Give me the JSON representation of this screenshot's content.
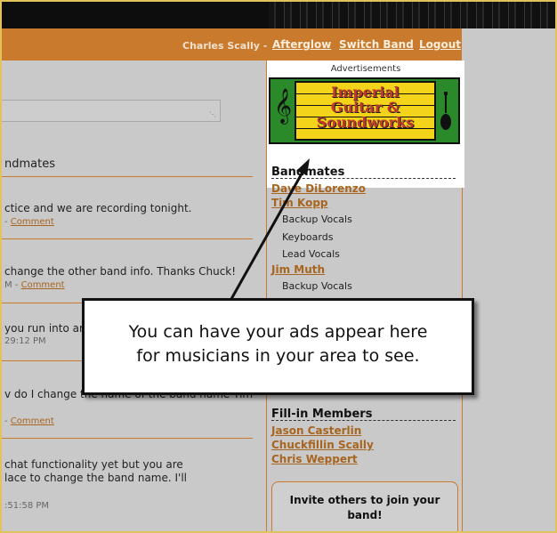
{
  "nav": {
    "user": "Charles Scally",
    "separator": "-",
    "links": [
      "Afterglow",
      "Switch Band",
      "Logout"
    ]
  },
  "left": {
    "bandmates_heading": "ndmates",
    "posts": [
      {
        "text": "ctice and we are recording tonight.",
        "meta": "- ",
        "comment": "Comment"
      },
      {
        "text": "change the other band info. Thanks Chuck!",
        "meta": "M - ",
        "comment": "Comment"
      },
      {
        "text": "you run into an",
        "meta": "29:12 PM",
        "comment": ""
      },
      {
        "text": "v do I change the name of the band name Tim",
        "meta": "- ",
        "comment": "Comment"
      },
      {
        "text": "chat functionality yet but you are",
        "text2": "lace to change the band name. I'll",
        "meta": ":51:58 PM",
        "comment": ""
      }
    ]
  },
  "ad": {
    "label": "Advertisements",
    "banner_lines": [
      "Imperial",
      "Guitar &",
      "Soundworks"
    ]
  },
  "bandmates": {
    "title": "Bandmates",
    "members": [
      {
        "name": "Dave  DiLorenzo",
        "roles": []
      },
      {
        "name": "Tim Kopp",
        "roles": [
          "Backup Vocals",
          "Keyboards",
          "Lead Vocals"
        ]
      },
      {
        "name": "Jim Muth",
        "roles": [
          "Backup Vocals"
        ]
      }
    ]
  },
  "fillin": {
    "title": "Fill-in Members",
    "members": [
      "Jason  Casterlin",
      "Chuckfillin Scally",
      "Chris Weppert"
    ]
  },
  "invite": {
    "line1": "Invite others to join your",
    "line2": "band!"
  },
  "callout": {
    "line1": "You can have your ads appear here",
    "line2": "for musicians in your area to see."
  },
  "colors": {
    "accent": "#c97a2c",
    "link": "#a8651f",
    "background": "#c9c9c9"
  },
  "icons": [
    "treble-clef-icon",
    "guitar-icon",
    "resize-grip-icon"
  ]
}
